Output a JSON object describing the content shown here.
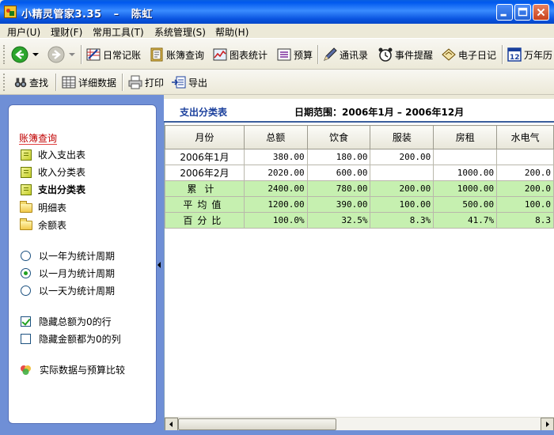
{
  "window": {
    "title": "小精灵管家3.35   –   陈虹",
    "buttons": [
      "minimize",
      "maximize",
      "close"
    ]
  },
  "menu": [
    {
      "label": "用户(U)"
    },
    {
      "label": "理财(F)"
    },
    {
      "label": "常用工具(T)"
    },
    {
      "label": "系统管理(S)"
    },
    {
      "label": "帮助(H)"
    }
  ],
  "toolbar": {
    "nav": {
      "back_icon": "back-arrow-icon",
      "forward_icon": "forward-arrow-icon"
    },
    "items": [
      {
        "label": "日常记账",
        "icon": "ledger-icon"
      },
      {
        "label": "账簿查询",
        "icon": "account-book-icon"
      },
      {
        "label": "图表统计",
        "icon": "chart-icon"
      },
      {
        "label": "预算",
        "icon": "budget-list-icon"
      },
      {
        "label": "通讯录",
        "icon": "pen-icon"
      },
      {
        "label": "事件提醒",
        "icon": "alarm-clock-icon"
      },
      {
        "label": "电子日记",
        "icon": "diary-icon"
      },
      {
        "label": "万年历",
        "icon": "calendar-icon"
      }
    ]
  },
  "toolbar2": {
    "items": [
      {
        "label": "查找",
        "icon": "binoculars-icon"
      },
      {
        "label": "详细数据",
        "icon": "detail-table-icon"
      },
      {
        "label": "打印",
        "icon": "printer-icon"
      },
      {
        "label": "导出",
        "icon": "export-icon"
      }
    ]
  },
  "sidebar": {
    "heading": "账簿查询",
    "reports": [
      {
        "label": "收入支出表",
        "icon": "report-file-icon",
        "bold": false
      },
      {
        "label": "收入分类表",
        "icon": "report-file-icon",
        "bold": false
      },
      {
        "label": "支出分类表",
        "icon": "report-file-icon",
        "bold": true
      },
      {
        "label": "明细表",
        "icon": "folder-icon",
        "bold": false
      },
      {
        "label": "余额表",
        "icon": "folder-icon",
        "bold": false
      }
    ],
    "periods": [
      {
        "label": "以一年为统计周期",
        "selected": false
      },
      {
        "label": "以一月为统计周期",
        "selected": true
      },
      {
        "label": "以一天为统计周期",
        "selected": false
      }
    ],
    "options": [
      {
        "label": "隐藏总额为0的行",
        "checked": true
      },
      {
        "label": "隐藏金额都为0的列",
        "checked": false
      }
    ],
    "compare_link": "实际数据与预算比较"
  },
  "report": {
    "title": "支出分类表",
    "range": "日期范围：2006年1月 – 2006年12月",
    "columns": [
      "月份",
      "总额",
      "饮食",
      "服装",
      "房租",
      "水电气"
    ],
    "rows": [
      {
        "cells": [
          "2006年1月",
          "380.00",
          "180.00",
          "200.00",
          "",
          ""
        ],
        "type": "data"
      },
      {
        "cells": [
          "2006年2月",
          "2020.00",
          "600.00",
          "",
          "1000.00",
          "200.0"
        ],
        "type": "data"
      },
      {
        "cells": [
          "累计",
          "2400.00",
          "780.00",
          "200.00",
          "1000.00",
          "200.0"
        ],
        "type": "sum"
      },
      {
        "cells": [
          "平均值",
          "1200.00",
          "390.00",
          "100.00",
          "500.00",
          "100.0"
        ],
        "type": "sum"
      },
      {
        "cells": [
          "百分比",
          "100.0%",
          "32.5%",
          "8.3%",
          "41.7%",
          "8.3"
        ],
        "type": "sum"
      }
    ]
  },
  "colors": {
    "titlebar": "#0058EE",
    "sidebar_frame": "#6F8FD6",
    "summary_row": "#C6F0B0",
    "heading_red": "#C00000",
    "report_title_blue": "#1A3F9C"
  }
}
